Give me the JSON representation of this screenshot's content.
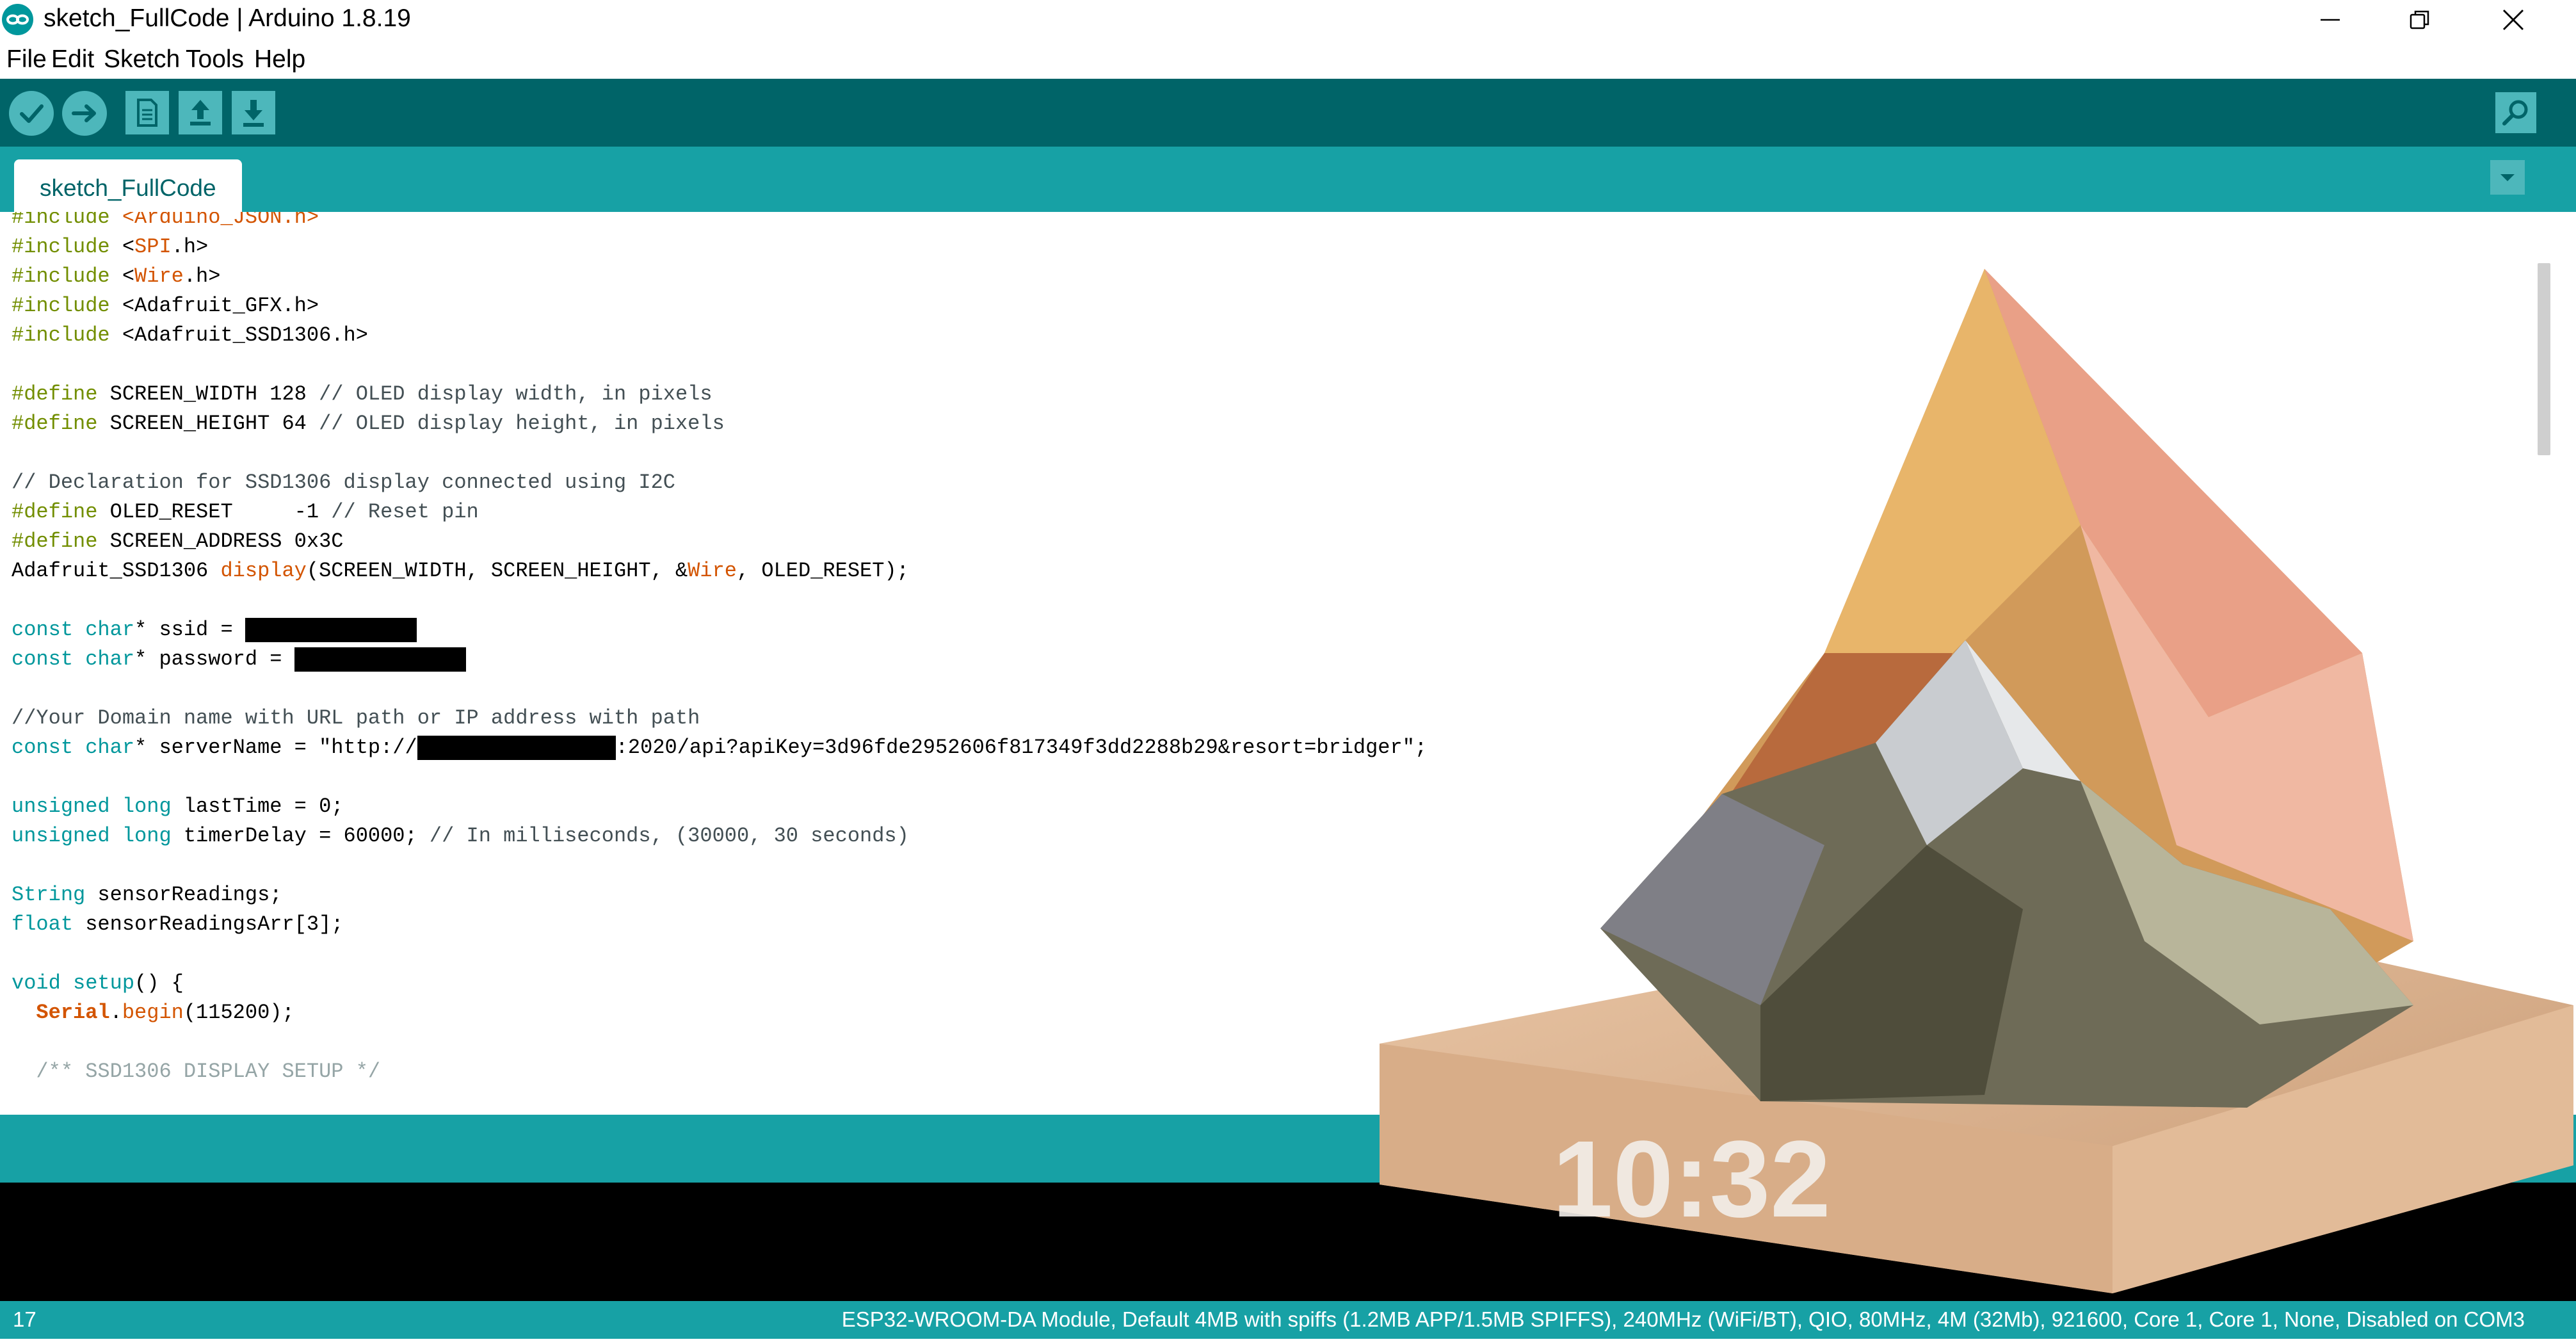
{
  "window": {
    "title": "sketch_FullCode | Arduino 1.8.19",
    "controls": [
      "minimize",
      "restore",
      "close"
    ]
  },
  "menu": [
    "File",
    "Edit",
    "Sketch",
    "Tools",
    "Help"
  ],
  "toolbar": {
    "buttons": [
      {
        "name": "verify",
        "icon": "check-icon"
      },
      {
        "name": "upload",
        "icon": "arrow-right-icon"
      },
      {
        "name": "new",
        "icon": "new-file-icon"
      },
      {
        "name": "open",
        "icon": "arrow-up-icon"
      },
      {
        "name": "save",
        "icon": "arrow-down-icon"
      },
      {
        "name": "serial-monitor",
        "icon": "magnifier-icon"
      }
    ]
  },
  "tabs": [
    {
      "label": "sketch_FullCode"
    }
  ],
  "editor": {
    "lines": [
      "#include <Arduino_JSON.h>",
      "#include <SPI.h>",
      "#include <Wire.h>",
      "#include <Adafruit_GFX.h>",
      "#include <Adafruit_SSD1306.h>",
      "",
      "#define SCREEN_WIDTH 128 // OLED display width, in pixels",
      "#define SCREEN_HEIGHT 64 // OLED display height, in pixels",
      "",
      "// Declaration for SSD1306 display connected using I2C",
      "#define OLED_RESET     -1 // Reset pin",
      "#define SCREEN_ADDRESS 0x3C",
      "Adafruit_SSD1306 display(SCREEN_WIDTH, SCREEN_HEIGHT, &Wire, OLED_RESET);",
      "",
      "const char* ssid = ",
      "const char* password = ",
      "",
      "//Your Domain name with URL path or IP address with path",
      "const char* serverName = \"http://",
      "",
      "unsigned long lastTime = 0;",
      "unsigned long timerDelay = 60000; // In milliseconds, (30000, 30 seconds)",
      "",
      "String sensorReadings;",
      "float sensorReadingsArr[3];",
      "",
      "void setup() {",
      "  Serial.begin(115200);",
      "",
      "  /** SSD1306 DISPLAY SETUP */"
    ],
    "server_suffix": ":2020/api?apiKey=3d96fde2952606f817349f3dd2288b29&resort=bridger\";"
  },
  "status": {
    "line_number": "17",
    "board": "ESP32-WROOM-DA Module, Default 4MB with spiffs (1.2MB APP/1.5MB SPIFFS), 240MHz (WiFi/BT), QIO, 80MHz, 4M (32Mb), 921600, Core 1, Core 1, None, Disabled on COM3"
  },
  "overlay": {
    "clock_text": "10:32"
  },
  "colors": {
    "toolbar_dark": "#006468",
    "teal": "#17a1a5",
    "button_light": "#4db7bb"
  }
}
